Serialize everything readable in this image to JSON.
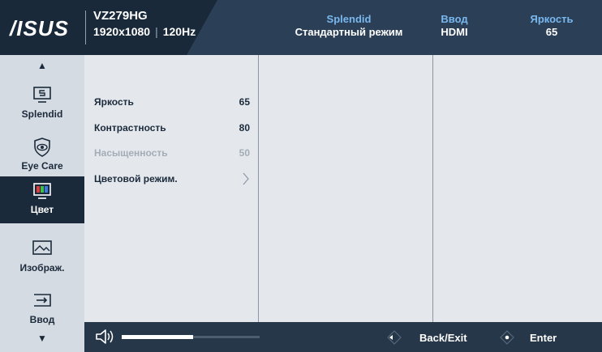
{
  "header": {
    "logo_text": "/ISUS",
    "model": "VZ279HG",
    "resolution": "1920x1080",
    "refresh_rate": "120Hz",
    "status": [
      {
        "key": "Splendid",
        "value": "Стандартный режим"
      },
      {
        "key": "Ввод",
        "value": "HDMI"
      },
      {
        "key": "Яркость",
        "value": "65"
      }
    ]
  },
  "nav": {
    "up_arrow": "▲",
    "down_arrow": "▼",
    "items": [
      {
        "label": "Splendid",
        "icon": "splendid-icon",
        "active": false
      },
      {
        "label": "Eye Care",
        "icon": "eye-care-icon",
        "active": false
      },
      {
        "label": "Цвет",
        "icon": "color-icon",
        "active": true
      },
      {
        "label": "Изображ.",
        "icon": "image-icon",
        "active": false
      },
      {
        "label": "Ввод",
        "icon": "input-icon",
        "active": false
      }
    ]
  },
  "settings": [
    {
      "label": "Яркость",
      "value": "65",
      "enabled": true
    },
    {
      "label": "Контрастность",
      "value": "80",
      "enabled": true
    },
    {
      "label": "Насыщенность",
      "value": "50",
      "enabled": false
    },
    {
      "label": "Цветовой режим.",
      "value": "",
      "enabled": true,
      "has_submenu": true
    }
  ],
  "footer": {
    "volume_level": 0.52,
    "back_label": "Back/Exit",
    "enter_label": "Enter"
  },
  "colors": {
    "header_bg": "#1b2a3b",
    "accent_blue": "#79b7ef",
    "nav_bg": "#d5dbe2",
    "panel_bg": "#e4e8ed",
    "footer_bg": "#263749"
  }
}
